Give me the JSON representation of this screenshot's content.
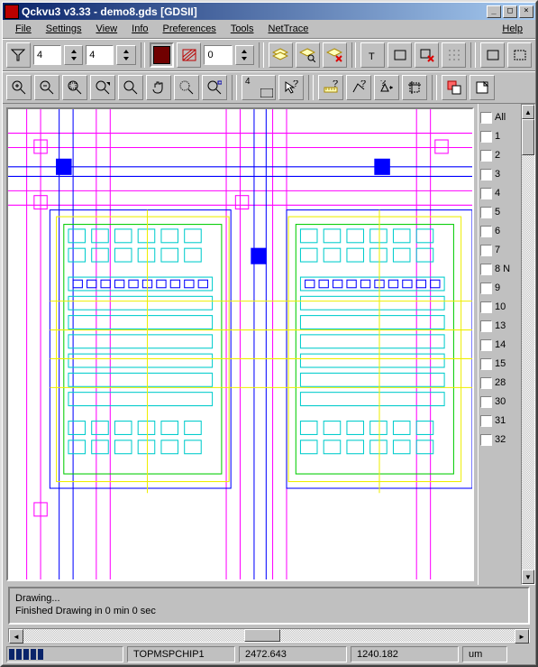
{
  "window": {
    "title": "Qckvu3 v3.33 - demo8.gds [GDSII]"
  },
  "menu": {
    "file": "File",
    "settings": "Settings",
    "view": "View",
    "info": "Info",
    "preferences": "Preferences",
    "tools": "Tools",
    "nettrace": "NetTrace",
    "help": "Help"
  },
  "toolbar1": {
    "field_a": "4",
    "field_b": "4",
    "field_c": "0"
  },
  "toolbar2": {
    "depth": "4"
  },
  "layers": {
    "all": "All",
    "items": [
      "1",
      "2",
      "3",
      "4",
      "5",
      "6",
      "7",
      "8 N",
      "9",
      "10",
      "13",
      "14",
      "15",
      "28",
      "30",
      "31",
      "32"
    ]
  },
  "status": {
    "line1": "Drawing...",
    "line2": "Finished Drawing in 0 min 0 sec"
  },
  "statusbar": {
    "cell": "TOPMSPCHIP1",
    "x": "2472.643",
    "y": "1240.182",
    "unit": "um"
  },
  "icons": {
    "funnel": "funnel-icon",
    "color": "color-well",
    "hatch": "hatch-icon",
    "layers": "layers-icon",
    "layers_find": "layers-find-icon",
    "layers_x": "layers-x-icon",
    "text_tool": "text-tool-icon",
    "rect_tool": "rect-tool-icon",
    "rect_x": "rect-x-icon",
    "dotgrid": "dotgrid-icon",
    "rect_open": "rect-open-icon",
    "marquee": "marquee-icon",
    "zoom_plus": "zoom-plus-icon",
    "zoom_minus": "zoom-minus-icon",
    "zoom_area": "zoom-area-icon",
    "zoom_arrow": "zoom-arrow-icon",
    "zoom": "zoom-icon",
    "pan": "pan-hand-icon",
    "zoom_dotted": "zoom-dotted-icon",
    "zoom_extents": "zoom-extents-icon",
    "depth": "depth-icon",
    "pointer_q": "pointer-query-icon",
    "ruler_q": "ruler-query-icon",
    "path_q": "path-query-icon",
    "convert_q": "convert-query-icon",
    "crop": "crop-icon",
    "overlay": "overlay-icon",
    "note": "note-icon"
  }
}
